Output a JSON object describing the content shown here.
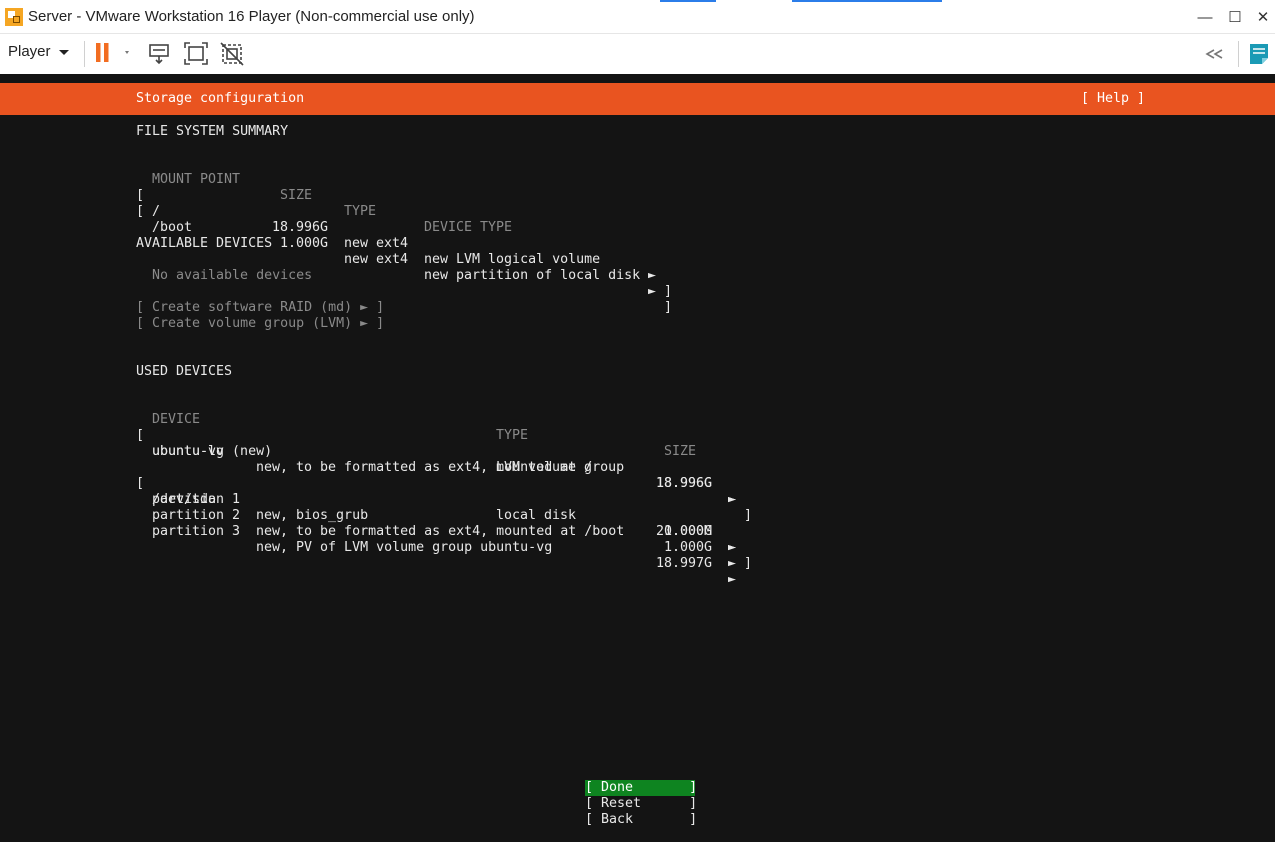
{
  "window": {
    "title": "Server - VMware Workstation 16 Player (Non-commercial use only)",
    "controls": {
      "minimize": "—",
      "maximize": "☐",
      "close": "✕"
    }
  },
  "toolbar": {
    "player_label": "Player",
    "icons": [
      "pause-icon",
      "send-ctrl-alt-del-icon",
      "full-screen-icon",
      "unity-icon",
      "collapse-icon",
      "notes-icon"
    ],
    "accent_colors": {
      "pause": "#f26d21",
      "notes": "#1a9ab5"
    }
  },
  "console": {
    "colors": {
      "header": "#e95420",
      "background": "#141414",
      "selected_button": "#0e8420",
      "dim_text": "#8a8a8a"
    },
    "header": {
      "title": "Storage configuration",
      "help": "[ Help ]"
    },
    "fs_summary": {
      "heading": "FILE SYSTEM SUMMARY",
      "columns": {
        "mount": "MOUNT POINT",
        "size": "SIZE",
        "type": "TYPE",
        "device_type": "DEVICE TYPE"
      },
      "rows": [
        {
          "open": "[",
          "mount": "/",
          "size": "18.996G",
          "type": "new ext4",
          "device_type": "new LVM logical volume",
          "arrow": "►",
          "close": "]"
        },
        {
          "open": "[",
          "mount": "/boot",
          "size": "1.000G",
          "type": "new ext4",
          "device_type": "new partition of local disk",
          "arrow": "►",
          "close": "]"
        }
      ]
    },
    "available": {
      "heading": "AVAILABLE DEVICES",
      "empty": "No available devices",
      "actions": [
        "[ Create software RAID (md) ► ]",
        "[ Create volume group (LVM) ► ]"
      ]
    },
    "used": {
      "heading": "USED DEVICES",
      "columns": {
        "device": "DEVICE",
        "type": "TYPE",
        "size": "SIZE"
      },
      "groups": [
        {
          "device": "ubuntu-vg (new)",
          "type": "LVM volume group",
          "size": "18.996G",
          "children": [
            {
              "name": "ubuntu-lv",
              "desc": "new, to be formatted as ext4, mounted at /",
              "size": "18.996G"
            }
          ]
        },
        {
          "device": "/dev/sda",
          "type": "local disk",
          "size": "20.000G",
          "children": [
            {
              "name": "partition 1",
              "desc": "new, bios_grub",
              "size": "1.000M"
            },
            {
              "name": "partition 2",
              "desc": "new, to be formatted as ext4, mounted at /boot",
              "size": "1.000G"
            },
            {
              "name": "partition 3",
              "desc": "new, PV of LVM volume group ubuntu-vg",
              "size": "18.997G"
            }
          ]
        }
      ]
    },
    "buttons": [
      {
        "label": "[ Done       ]"
      },
      {
        "label": "[ Reset      ]"
      },
      {
        "label": "[ Back       ]"
      }
    ]
  }
}
